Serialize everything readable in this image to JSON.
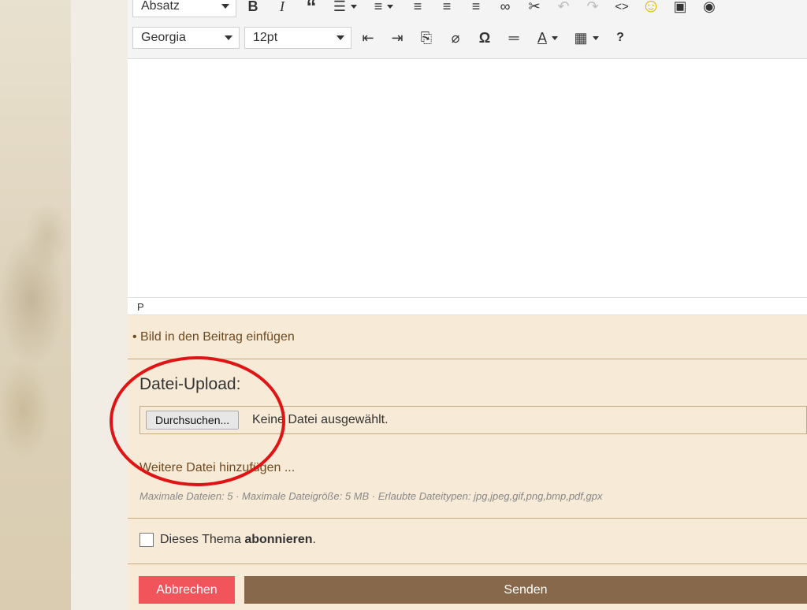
{
  "toolbar": {
    "format_select": "Absatz",
    "font_select": "Georgia",
    "size_select": "12pt",
    "icons_row1": [
      "B",
      "I",
      "“",
      "☰",
      "≡",
      "≡",
      "≡",
      "≡",
      "∞",
      "✂",
      "↶",
      "↷",
      "<>",
      "☺",
      "▣",
      "◉"
    ],
    "icons_row2": [
      "⇤",
      "⇥",
      "⎘",
      "⌀",
      "Ω",
      "═",
      "A",
      "▦",
      "?"
    ]
  },
  "editor": {
    "status_path": "P"
  },
  "attachments": {
    "insert_image_link": "Bild in den Beitrag einfügen",
    "upload_title": "Datei-Upload:",
    "browse_button": "Durchsuchen...",
    "file_status": "Keine Datei ausgewählt.",
    "add_file_link": "Weitere Datei hinzufügen ...",
    "limits": "Maximale Dateien: 5 · Maximale Dateigröße: 5 MB · Erlaubte Dateitypen: jpg,jpeg,gif,png,bmp,pdf,gpx"
  },
  "subscribe": {
    "prefix": "Dieses Thema",
    "bold": "abonnieren",
    "suffix": "."
  },
  "actions": {
    "cancel": "Abbrechen",
    "send": "Senden"
  },
  "colors": {
    "cancel_bg": "#f2545b",
    "send_bg": "#87684a",
    "panel_bg": "#f7ead6",
    "link": "#6e4a22",
    "annotation": "#e01414"
  }
}
